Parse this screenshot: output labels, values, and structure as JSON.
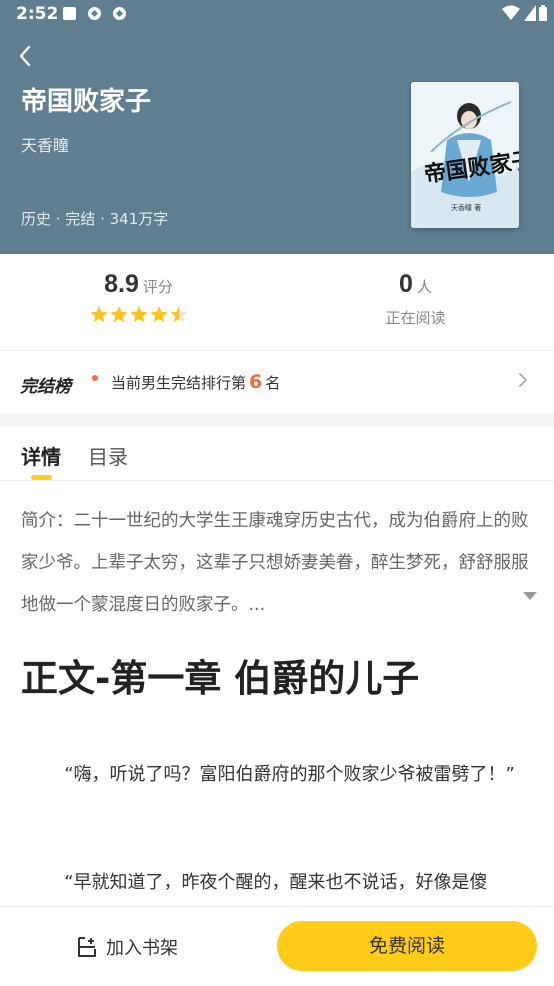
{
  "status_bar": {
    "time": "2:52",
    "left_icons": [
      "square-icon",
      "sync-icon",
      "sync-icon"
    ],
    "right_icons": [
      "wifi-icon",
      "signal-icon",
      "battery-icon"
    ]
  },
  "book": {
    "title": "帝国败家子",
    "author": "天香瞳",
    "meta": "历史 · 完结 · 341万字",
    "cover_text": "帝国败家子",
    "cover_small": "天香瞳 著"
  },
  "stats": {
    "rating": "8.9",
    "rating_unit": "评分",
    "rating_stars": 4.5,
    "readers": "0",
    "readers_unit": "人",
    "readers_label": "正在阅读"
  },
  "rank": {
    "badge": "完结榜",
    "prefix": "当前男生完结排行第",
    "number": "6",
    "suffix": "名"
  },
  "tabs": [
    "详情",
    "目录"
  ],
  "intro": "简介：二十一世纪的大学生王康魂穿历史古代，成为伯爵府上的败家少爷。上辈子太穷，这辈子只想娇妻美眷，醉生梦死，舒舒服服地做一个蒙混度日的败家子。...",
  "chapter": {
    "title": "正文-第一章 伯爵的儿子",
    "paragraphs": [
      "“嗨，听说了吗？富阳伯爵府的那个败家少爷被雷劈了！”",
      "“早就知道了，昨夜个醒的，醒来也不说话，好像是傻"
    ]
  },
  "bottom_bar": {
    "shelf_label": "加入书架",
    "read_label": "免费阅读"
  },
  "colors": {
    "header_bg": "#5f7f91",
    "accent": "#ffcc1a",
    "rank_accent": "#f26b3a"
  }
}
